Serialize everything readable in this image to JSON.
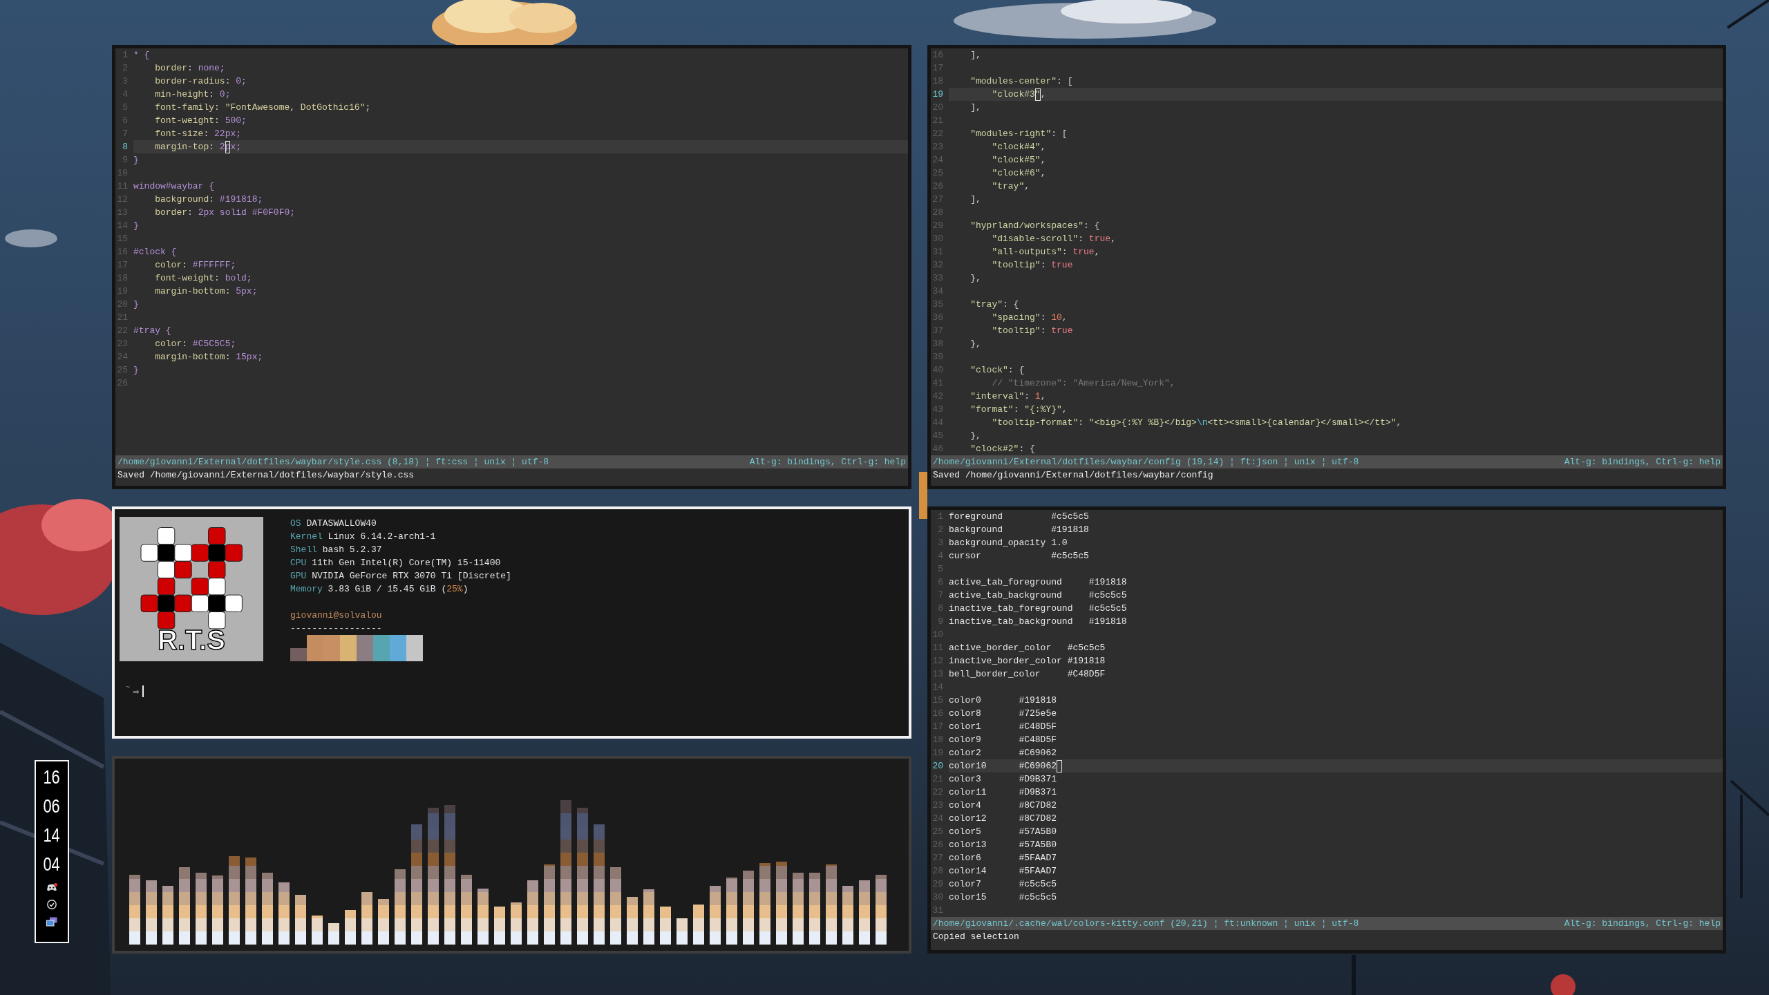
{
  "windows": [
    {
      "kind": "editor",
      "focused": false,
      "lines": [
        {
          "number": "1",
          "selected": false,
          "segments": [
            {
              "kind": "selector",
              "text": "* {"
            }
          ]
        },
        {
          "number": "2",
          "selected": false,
          "segments": [
            {
              "kind": "property",
              "text": "    border"
            },
            {
              "kind": "punct",
              "text": ": "
            },
            {
              "kind": "value",
              "text": "none;"
            }
          ]
        },
        {
          "number": "3",
          "selected": false,
          "segments": [
            {
              "kind": "property",
              "text": "    border-radius"
            },
            {
              "kind": "punct",
              "text": ": "
            },
            {
              "kind": "value",
              "text": "0;"
            }
          ]
        },
        {
          "number": "4",
          "selected": false,
          "segments": [
            {
              "kind": "property",
              "text": "    min-height"
            },
            {
              "kind": "punct",
              "text": ": "
            },
            {
              "kind": "value",
              "text": "0;"
            }
          ]
        },
        {
          "number": "5",
          "selected": false,
          "segments": [
            {
              "kind": "property",
              "text": "    font-family"
            },
            {
              "kind": "punct",
              "text": ": "
            },
            {
              "kind": "string",
              "text": "\"FontAwesome, DotGothic16\""
            },
            {
              "kind": "punct",
              "text": ";"
            }
          ]
        },
        {
          "number": "6",
          "selected": false,
          "segments": [
            {
              "kind": "property",
              "text": "    font-weight"
            },
            {
              "kind": "punct",
              "text": ": "
            },
            {
              "kind": "value",
              "text": "500;"
            }
          ]
        },
        {
          "number": "7",
          "selected": false,
          "segments": [
            {
              "kind": "property",
              "text": "    font-size"
            },
            {
              "kind": "punct",
              "text": ": "
            },
            {
              "kind": "value",
              "text": "22px;"
            }
          ]
        },
        {
          "number": "8",
          "selected": true,
          "segments": [
            {
              "kind": "property",
              "text": "    margin-top"
            },
            {
              "kind": "punct",
              "text": ": "
            },
            {
              "kind": "value",
              "text": "2"
            },
            {
              "kind": "cursor",
              "text": "p"
            },
            {
              "kind": "value",
              "text": "x;"
            }
          ]
        },
        {
          "number": "9",
          "selected": false,
          "segments": [
            {
              "kind": "selector",
              "text": "}"
            }
          ]
        },
        {
          "number": "10",
          "selected": false
        },
        {
          "number": "11",
          "selected": false,
          "segments": [
            {
              "kind": "selector",
              "text": "window#waybar {"
            }
          ]
        },
        {
          "number": "12",
          "selected": false,
          "segments": [
            {
              "kind": "property",
              "text": "    background"
            },
            {
              "kind": "punct",
              "text": ": "
            },
            {
              "kind": "value",
              "text": "#191818;"
            }
          ]
        },
        {
          "number": "13",
          "selected": false,
          "segments": [
            {
              "kind": "property",
              "text": "    border"
            },
            {
              "kind": "punct",
              "text": ": "
            },
            {
              "kind": "value",
              "text": "2px solid #F0F0F0;"
            }
          ]
        },
        {
          "number": "14",
          "selected": false,
          "segments": [
            {
              "kind": "selector",
              "text": "}"
            }
          ]
        },
        {
          "number": "15",
          "selected": false
        },
        {
          "number": "16",
          "selected": false,
          "segments": [
            {
              "kind": "selector",
              "text": "#clock {"
            }
          ]
        },
        {
          "number": "17",
          "selected": false,
          "segments": [
            {
              "kind": "property",
              "text": "    color"
            },
            {
              "kind": "punct",
              "text": ": "
            },
            {
              "kind": "value",
              "text": "#FFFFFF;"
            }
          ]
        },
        {
          "number": "18",
          "selected": false,
          "segments": [
            {
              "kind": "property",
              "text": "    font-weight"
            },
            {
              "kind": "punct",
              "text": ": "
            },
            {
              "kind": "value",
              "text": "bold;"
            }
          ]
        },
        {
          "number": "19",
          "selected": false,
          "segments": [
            {
              "kind": "property",
              "text": "    margin-bottom"
            },
            {
              "kind": "punct",
              "text": ": "
            },
            {
              "kind": "value",
              "text": "5px;"
            }
          ]
        },
        {
          "number": "20",
          "selected": false,
          "segments": [
            {
              "kind": "selector",
              "text": "}"
            }
          ]
        },
        {
          "number": "21",
          "selected": false
        },
        {
          "number": "22",
          "selected": false,
          "segments": [
            {
              "kind": "selector",
              "text": "#tray {"
            }
          ]
        },
        {
          "number": "23",
          "selected": false,
          "segments": [
            {
              "kind": "property",
              "text": "    color"
            },
            {
              "kind": "punct",
              "text": ": "
            },
            {
              "kind": "value",
              "text": "#C5C5C5;"
            }
          ]
        },
        {
          "number": "24",
          "selected": false,
          "segments": [
            {
              "kind": "property",
              "text": "    margin-bottom"
            },
            {
              "kind": "punct",
              "text": ": "
            },
            {
              "kind": "value",
              "text": "15px;"
            }
          ]
        },
        {
          "number": "25",
          "selected": false,
          "segments": [
            {
              "kind": "selector",
              "text": "}"
            }
          ]
        },
        {
          "number": "26",
          "selected": false
        }
      ],
      "status": {
        "file": "/home/giovanni/External/dotfiles/waybar/style.css (8,18) ¦ ft:css ¦ unix ¦ utf-8",
        "hints": "Alt-g: bindings, Ctrl-g: help"
      },
      "message": "Saved /home/giovanni/External/dotfiles/waybar/style.css"
    },
    {
      "kind": "editor",
      "focused": false,
      "lines": [
        {
          "number": "16",
          "selected": false,
          "segments": [
            {
              "kind": "punct",
              "text": "    ],"
            }
          ]
        },
        {
          "number": "17",
          "selected": false
        },
        {
          "number": "18",
          "selected": false,
          "segments": [
            {
              "kind": "key",
              "text": "    \"modules-center\""
            },
            {
              "kind": "punct",
              "text": ": ["
            }
          ]
        },
        {
          "number": "19",
          "selected": true,
          "segments": [
            {
              "kind": "key",
              "text": "        \"clock#3"
            },
            {
              "kind": "cursor",
              "text": "\""
            },
            {
              "kind": "punct",
              "text": ","
            }
          ]
        },
        {
          "number": "20",
          "selected": false,
          "segments": [
            {
              "kind": "punct",
              "text": "    ],"
            }
          ]
        },
        {
          "number": "21",
          "selected": false
        },
        {
          "number": "22",
          "selected": false,
          "segments": [
            {
              "kind": "key",
              "text": "    \"modules-right\""
            },
            {
              "kind": "punct",
              "text": ": ["
            }
          ]
        },
        {
          "number": "23",
          "selected": false,
          "segments": [
            {
              "kind": "key",
              "text": "        \"clock#4\""
            },
            {
              "kind": "punct",
              "text": ","
            }
          ]
        },
        {
          "number": "24",
          "selected": false,
          "segments": [
            {
              "kind": "key",
              "text": "        \"clock#5\""
            },
            {
              "kind": "punct",
              "text": ","
            }
          ]
        },
        {
          "number": "25",
          "selected": false,
          "segments": [
            {
              "kind": "key",
              "text": "        \"clock#6\""
            },
            {
              "kind": "punct",
              "text": ","
            }
          ]
        },
        {
          "number": "26",
          "selected": false,
          "segments": [
            {
              "kind": "key",
              "text": "        \"tray\""
            },
            {
              "kind": "punct",
              "text": ","
            }
          ]
        },
        {
          "number": "27",
          "selected": false,
          "segments": [
            {
              "kind": "punct",
              "text": "    ],"
            }
          ]
        },
        {
          "number": "28",
          "selected": false
        },
        {
          "number": "29",
          "selected": false,
          "segments": [
            {
              "kind": "key",
              "text": "    \"hyprland/workspaces\""
            },
            {
              "kind": "punct",
              "text": ": {"
            }
          ]
        },
        {
          "number": "30",
          "selected": false,
          "segments": [
            {
              "kind": "key",
              "text": "        \"disable-scroll\""
            },
            {
              "kind": "punct",
              "text": ": "
            },
            {
              "kind": "bool",
              "text": "true"
            },
            {
              "kind": "punct",
              "text": ","
            }
          ]
        },
        {
          "number": "31",
          "selected": false,
          "segments": [
            {
              "kind": "key",
              "text": "        \"all-outputs\""
            },
            {
              "kind": "punct",
              "text": ": "
            },
            {
              "kind": "bool",
              "text": "true"
            },
            {
              "kind": "punct",
              "text": ","
            }
          ]
        },
        {
          "number": "32",
          "selected": false,
          "segments": [
            {
              "kind": "key",
              "text": "        \"tooltip\""
            },
            {
              "kind": "punct",
              "text": ": "
            },
            {
              "kind": "bool",
              "text": "true"
            }
          ]
        },
        {
          "number": "33",
          "selected": false,
          "segments": [
            {
              "kind": "punct",
              "text": "    },"
            }
          ]
        },
        {
          "number": "34",
          "selected": false
        },
        {
          "number": "35",
          "selected": false,
          "segments": [
            {
              "kind": "key",
              "text": "    \"tray\""
            },
            {
              "kind": "punct",
              "text": ": {"
            }
          ]
        },
        {
          "number": "36",
          "selected": false,
          "segments": [
            {
              "kind": "key",
              "text": "        \"spacing\""
            },
            {
              "kind": "punct",
              "text": ": "
            },
            {
              "kind": "number",
              "text": "10"
            },
            {
              "kind": "punct",
              "text": ","
            }
          ]
        },
        {
          "number": "37",
          "selected": false,
          "segments": [
            {
              "kind": "key",
              "text": "        \"tooltip\""
            },
            {
              "kind": "punct",
              "text": ": "
            },
            {
              "kind": "bool",
              "text": "true"
            }
          ]
        },
        {
          "number": "38",
          "selected": false,
          "segments": [
            {
              "kind": "punct",
              "text": "    },"
            }
          ]
        },
        {
          "number": "39",
          "selected": false
        },
        {
          "number": "40",
          "selected": false,
          "segments": [
            {
              "kind": "key",
              "text": "    \"clock\""
            },
            {
              "kind": "punct",
              "text": ": {"
            }
          ]
        },
        {
          "number": "41",
          "selected": false,
          "segments": [
            {
              "kind": "comment",
              "text": "        // \"timezone\": \"America/New_York\","
            }
          ]
        },
        {
          "number": "42",
          "selected": false,
          "segments": [
            {
              "kind": "key",
              "text": "    \"interval\""
            },
            {
              "kind": "punct",
              "text": ": "
            },
            {
              "kind": "number",
              "text": "1"
            },
            {
              "kind": "punct",
              "text": ","
            }
          ]
        },
        {
          "number": "43",
          "selected": false,
          "segments": [
            {
              "kind": "key",
              "text": "    \"format\""
            },
            {
              "kind": "punct",
              "text": ": "
            },
            {
              "kind": "key",
              "text": "\"{:%Y}\""
            },
            {
              "kind": "punct",
              "text": ","
            }
          ]
        },
        {
          "number": "44",
          "selected": false,
          "segments": [
            {
              "kind": "key",
              "text": "        \"tooltip-format\""
            },
            {
              "kind": "punct",
              "text": ": "
            },
            {
              "kind": "key",
              "text": "\"<big>{:%Y %B}</big>"
            },
            {
              "kind": "escape",
              "text": "\\n"
            },
            {
              "kind": "key",
              "text": "<tt><small>{calendar}</small></tt>\""
            },
            {
              "kind": "punct",
              "text": ","
            }
          ]
        },
        {
          "number": "45",
          "selected": false,
          "segments": [
            {
              "kind": "punct",
              "text": "    },"
            }
          ]
        },
        {
          "number": "46",
          "selected": false,
          "segments": [
            {
              "kind": "key",
              "text": "    \"clock#2\""
            },
            {
              "kind": "punct",
              "text": ": {"
            }
          ]
        }
      ],
      "status": {
        "file": "/home/giovanni/External/dotfiles/waybar/config (19,14) ¦ ft:json ¦ unix ¦ utf-8",
        "hints": "Alt-g: bindings, Ctrl-g: help"
      },
      "message": "Saved /home/giovanni/External/dotfiles/waybar/config"
    },
    {
      "kind": "fetch",
      "focused": true,
      "logo_text": "R.T.S",
      "info": [
        {
          "label": "OS",
          "parts": [
            {
              "kind": "plain",
              "text": "DATASWALLOW40"
            }
          ]
        },
        {
          "label": "Kernel",
          "parts": [
            {
              "kind": "plain",
              "text": "Linux 6.14.2-arch1-1"
            }
          ]
        },
        {
          "label": "Shell",
          "parts": [
            {
              "kind": "plain",
              "text": "bash 5.2.37"
            }
          ]
        },
        {
          "label": "CPU",
          "parts": [
            {
              "kind": "plain",
              "text": "11th Gen Intel(R) Core(TM) i5-11400"
            }
          ]
        },
        {
          "label": "GPU",
          "parts": [
            {
              "kind": "plain",
              "text": "NVIDIA GeForce RTX 3070 Ti [Discrete]"
            }
          ]
        },
        {
          "label": "Memory",
          "parts": [
            {
              "kind": "plain",
              "text": "3.83 GiB / 15.45 GiB ("
            },
            {
              "kind": "accent",
              "text": "25%"
            },
            {
              "kind": "plain",
              "text": ")"
            }
          ]
        }
      ],
      "user_host": "giovanni@solvalou",
      "separator": "-----------------",
      "palette_rows": [
        {
          "swatches": [
            {
              "color": "#c48d5f"
            },
            {
              "color": "#c69062"
            },
            {
              "color": "#d9b371"
            },
            {
              "color": "#8c7d82"
            },
            {
              "color": "#57a5b0"
            },
            {
              "color": "#5faad7"
            },
            {
              "color": "#c5c5c5"
            }
          ]
        },
        {
          "swatches": [
            {
              "color": "#725e5e"
            },
            {
              "color": "#c48d5f"
            },
            {
              "color": "#c69062"
            },
            {
              "color": "#d9b371"
            },
            {
              "color": "#8c7d82"
            },
            {
              "color": "#57a5b0"
            },
            {
              "color": "#5faad7"
            },
            {
              "color": "#c5c5c5"
            }
          ]
        }
      ],
      "prompt": {
        "dir": "~",
        "symbol": "⇨"
      }
    },
    {
      "kind": "editor",
      "focused": false,
      "lines": [
        {
          "number": "1",
          "selected": false,
          "segments": [
            {
              "kind": "plain",
              "text": "foreground         #c5c5c5"
            }
          ]
        },
        {
          "number": "2",
          "selected": false,
          "segments": [
            {
              "kind": "plain",
              "text": "background         #191818"
            }
          ]
        },
        {
          "number": "3",
          "selected": false,
          "segments": [
            {
              "kind": "plain",
              "text": "background_opacity 1.0"
            }
          ]
        },
        {
          "number": "4",
          "selected": false,
          "segments": [
            {
              "kind": "plain",
              "text": "cursor             #c5c5c5"
            }
          ]
        },
        {
          "number": "5",
          "selected": false
        },
        {
          "number": "6",
          "selected": false,
          "segments": [
            {
              "kind": "plain",
              "text": "active_tab_foreground     #191818"
            }
          ]
        },
        {
          "number": "7",
          "selected": false,
          "segments": [
            {
              "kind": "plain",
              "text": "active_tab_background     #c5c5c5"
            }
          ]
        },
        {
          "number": "8",
          "selected": false,
          "segments": [
            {
              "kind": "plain",
              "text": "inactive_tab_foreground   #c5c5c5"
            }
          ]
        },
        {
          "number": "9",
          "selected": false,
          "segments": [
            {
              "kind": "plain",
              "text": "inactive_tab_background   #191818"
            }
          ]
        },
        {
          "number": "10",
          "selected": false
        },
        {
          "number": "11",
          "selected": false,
          "segments": [
            {
              "kind": "plain",
              "text": "active_border_color   #c5c5c5"
            }
          ]
        },
        {
          "number": "12",
          "selected": false,
          "segments": [
            {
              "kind": "plain",
              "text": "inactive_border_color #191818"
            }
          ]
        },
        {
          "number": "13",
          "selected": false,
          "segments": [
            {
              "kind": "plain",
              "text": "bell_border_color     #C48D5F"
            }
          ]
        },
        {
          "number": "14",
          "selected": false
        },
        {
          "number": "15",
          "selected": false,
          "segments": [
            {
              "kind": "plain",
              "text": "color0       #191818"
            }
          ]
        },
        {
          "number": "16",
          "selected": false,
          "segments": [
            {
              "kind": "plain",
              "text": "color8       #725e5e"
            }
          ]
        },
        {
          "number": "17",
          "selected": false,
          "segments": [
            {
              "kind": "plain",
              "text": "color1       #C48D5F"
            }
          ]
        },
        {
          "number": "18",
          "selected": false,
          "segments": [
            {
              "kind": "plain",
              "text": "color9       #C48D5F"
            }
          ]
        },
        {
          "number": "19",
          "selected": false,
          "segments": [
            {
              "kind": "plain",
              "text": "color2       #C69062"
            }
          ]
        },
        {
          "number": "20",
          "selected": true,
          "cursor_at_end": true,
          "segments": [
            {
              "kind": "plain",
              "text": "color10      #C69062"
            }
          ]
        },
        {
          "number": "21",
          "selected": false,
          "segments": [
            {
              "kind": "plain",
              "text": "color3       #D9B371"
            }
          ]
        },
        {
          "number": "22",
          "selected": false,
          "segments": [
            {
              "kind": "plain",
              "text": "color11      #D9B371"
            }
          ]
        },
        {
          "number": "23",
          "selected": false,
          "segments": [
            {
              "kind": "plain",
              "text": "color4       #8C7D82"
            }
          ]
        },
        {
          "number": "24",
          "selected": false,
          "segments": [
            {
              "kind": "plain",
              "text": "color12      #8C7D82"
            }
          ]
        },
        {
          "number": "25",
          "selected": false,
          "segments": [
            {
              "kind": "plain",
              "text": "color5       #57A5B0"
            }
          ]
        },
        {
          "number": "26",
          "selected": false,
          "segments": [
            {
              "kind": "plain",
              "text": "color13      #57A5B0"
            }
          ]
        },
        {
          "number": "27",
          "selected": false,
          "segments": [
            {
              "kind": "plain",
              "text": "color6       #5FAAD7"
            }
          ]
        },
        {
          "number": "28",
          "selected": false,
          "segments": [
            {
              "kind": "plain",
              "text": "color14      #5FAAD7"
            }
          ]
        },
        {
          "number": "29",
          "selected": false,
          "segments": [
            {
              "kind": "plain",
              "text": "color7       #c5c5c5"
            }
          ]
        },
        {
          "number": "30",
          "selected": false,
          "segments": [
            {
              "kind": "plain",
              "text": "color15      #c5c5c5"
            }
          ]
        },
        {
          "number": "31",
          "selected": false
        }
      ],
      "status": {
        "file": "/home/giovanni/.cache/wal/colors-kitty.conf (20,21) ¦ ft:unknown ¦ unix ¦ utf-8",
        "hints": "Alt-g: bindings, Ctrl-g: help"
      },
      "message": "Copied selection"
    },
    {
      "kind": "visualizer",
      "focused": false
    }
  ],
  "waybar": {
    "clocks": [
      "16",
      "06",
      "14",
      "04"
    ]
  }
}
